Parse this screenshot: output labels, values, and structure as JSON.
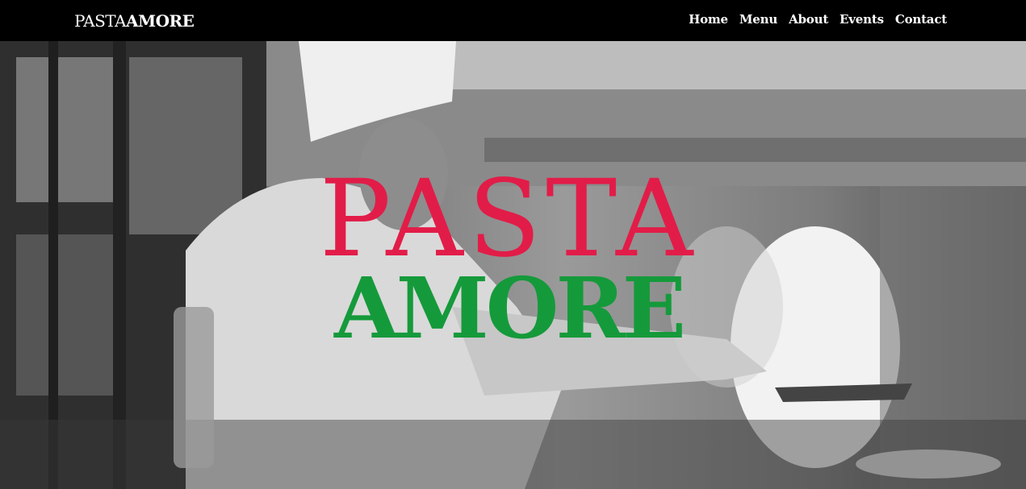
{
  "brand": {
    "part1": "PASTA",
    "part2": "AMORE"
  },
  "nav": {
    "items": [
      "Home",
      "Menu",
      "About",
      "Events",
      "Contact"
    ]
  },
  "hero": {
    "logo_top": "PASTA",
    "logo_bottom": "AMORE",
    "logo_top_color": "#e21c48",
    "logo_bottom_color": "#159a3b",
    "image_subject": "chef-cooking-photo"
  }
}
